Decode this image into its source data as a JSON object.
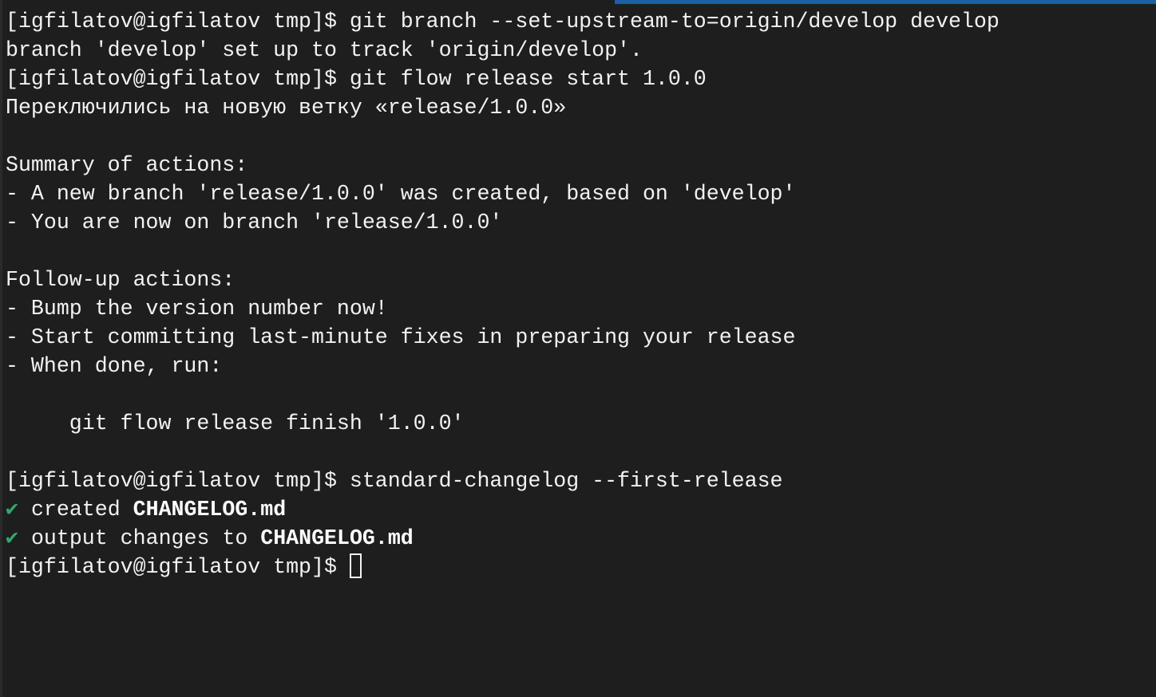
{
  "colors": {
    "background": "#1e1e1e",
    "text": "#f2f2f2",
    "check": "#2fa86a",
    "accent_bar": "#1f5fa8"
  },
  "terminal": {
    "lines": [
      "[igfilatov@igfilatov tmp]$ git branch --set-upstream-to=origin/develop develop",
      "branch 'develop' set up to track 'origin/develop'.",
      "[igfilatov@igfilatov tmp]$ git flow release start 1.0.0",
      "Переключились на новую ветку «release/1.0.0»",
      "",
      "Summary of actions:",
      "- A new branch 'release/1.0.0' was created, based on 'develop'",
      "- You are now on branch 'release/1.0.0'",
      "",
      "Follow-up actions:",
      "- Bump the version number now!",
      "- Start committing last-minute fixes in preparing your release",
      "- When done, run:",
      "",
      "     git flow release finish '1.0.0'",
      "",
      "[igfilatov@igfilatov tmp]$ standard-changelog --first-release"
    ],
    "created": {
      "icon": "check-icon",
      "glyph": "✔",
      "text": " created ",
      "file": "CHANGELOG.md"
    },
    "output": {
      "icon": "check-icon",
      "glyph": "✔",
      "text": " output changes to ",
      "file": "CHANGELOG.md"
    },
    "prompt": "[igfilatov@igfilatov tmp]$ "
  }
}
